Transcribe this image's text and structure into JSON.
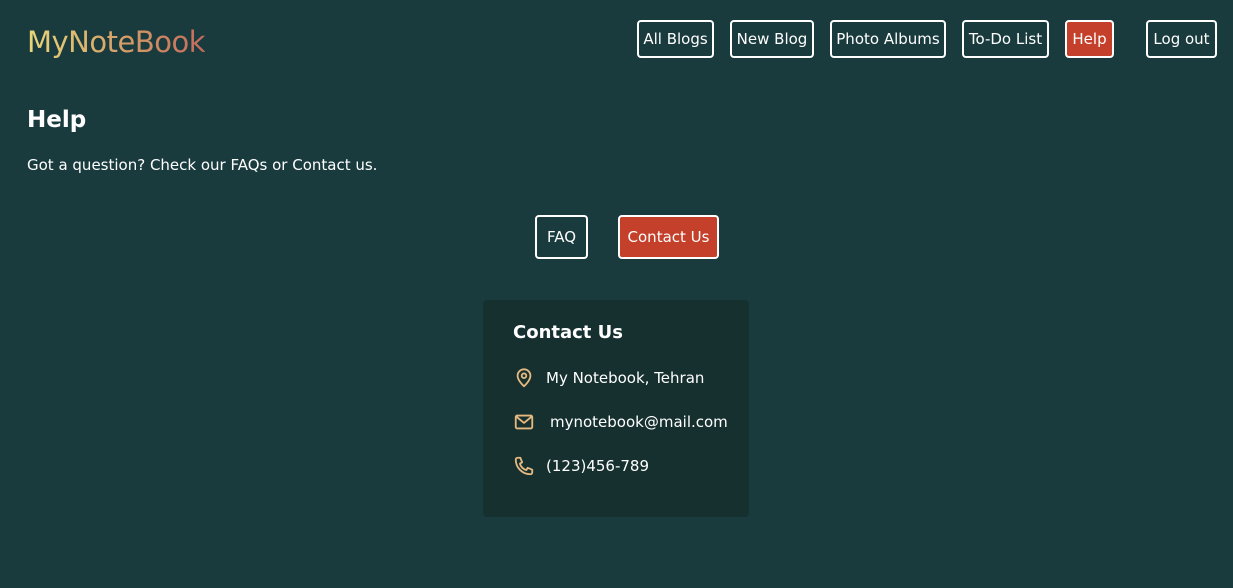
{
  "app": {
    "logo": "MyNoteBook"
  },
  "nav": {
    "items": [
      {
        "label": "All Blogs"
      },
      {
        "label": "New Blog"
      },
      {
        "label": "Photo Albums"
      },
      {
        "label": "To-Do List"
      },
      {
        "label": "Help"
      },
      {
        "label": "Log out"
      }
    ],
    "active": "Help"
  },
  "page": {
    "title": "Help",
    "description": "Got a question? Check our FAQs or Contact us."
  },
  "tabs": {
    "faq_label": "FAQ",
    "contact_label": "Contact Us",
    "active": "Contact Us"
  },
  "contact_card": {
    "title": "Contact Us",
    "address": "My Notebook, Tehran",
    "email": "mynotebook@mail.com",
    "phone": "(123)456-789",
    "icons": [
      "location-pin-icon",
      "mail-icon",
      "phone-icon"
    ]
  },
  "colors": {
    "background": "#1a3b3e",
    "card": "#15302f",
    "accent": "#c4402a",
    "icon": "#e5b87f"
  }
}
